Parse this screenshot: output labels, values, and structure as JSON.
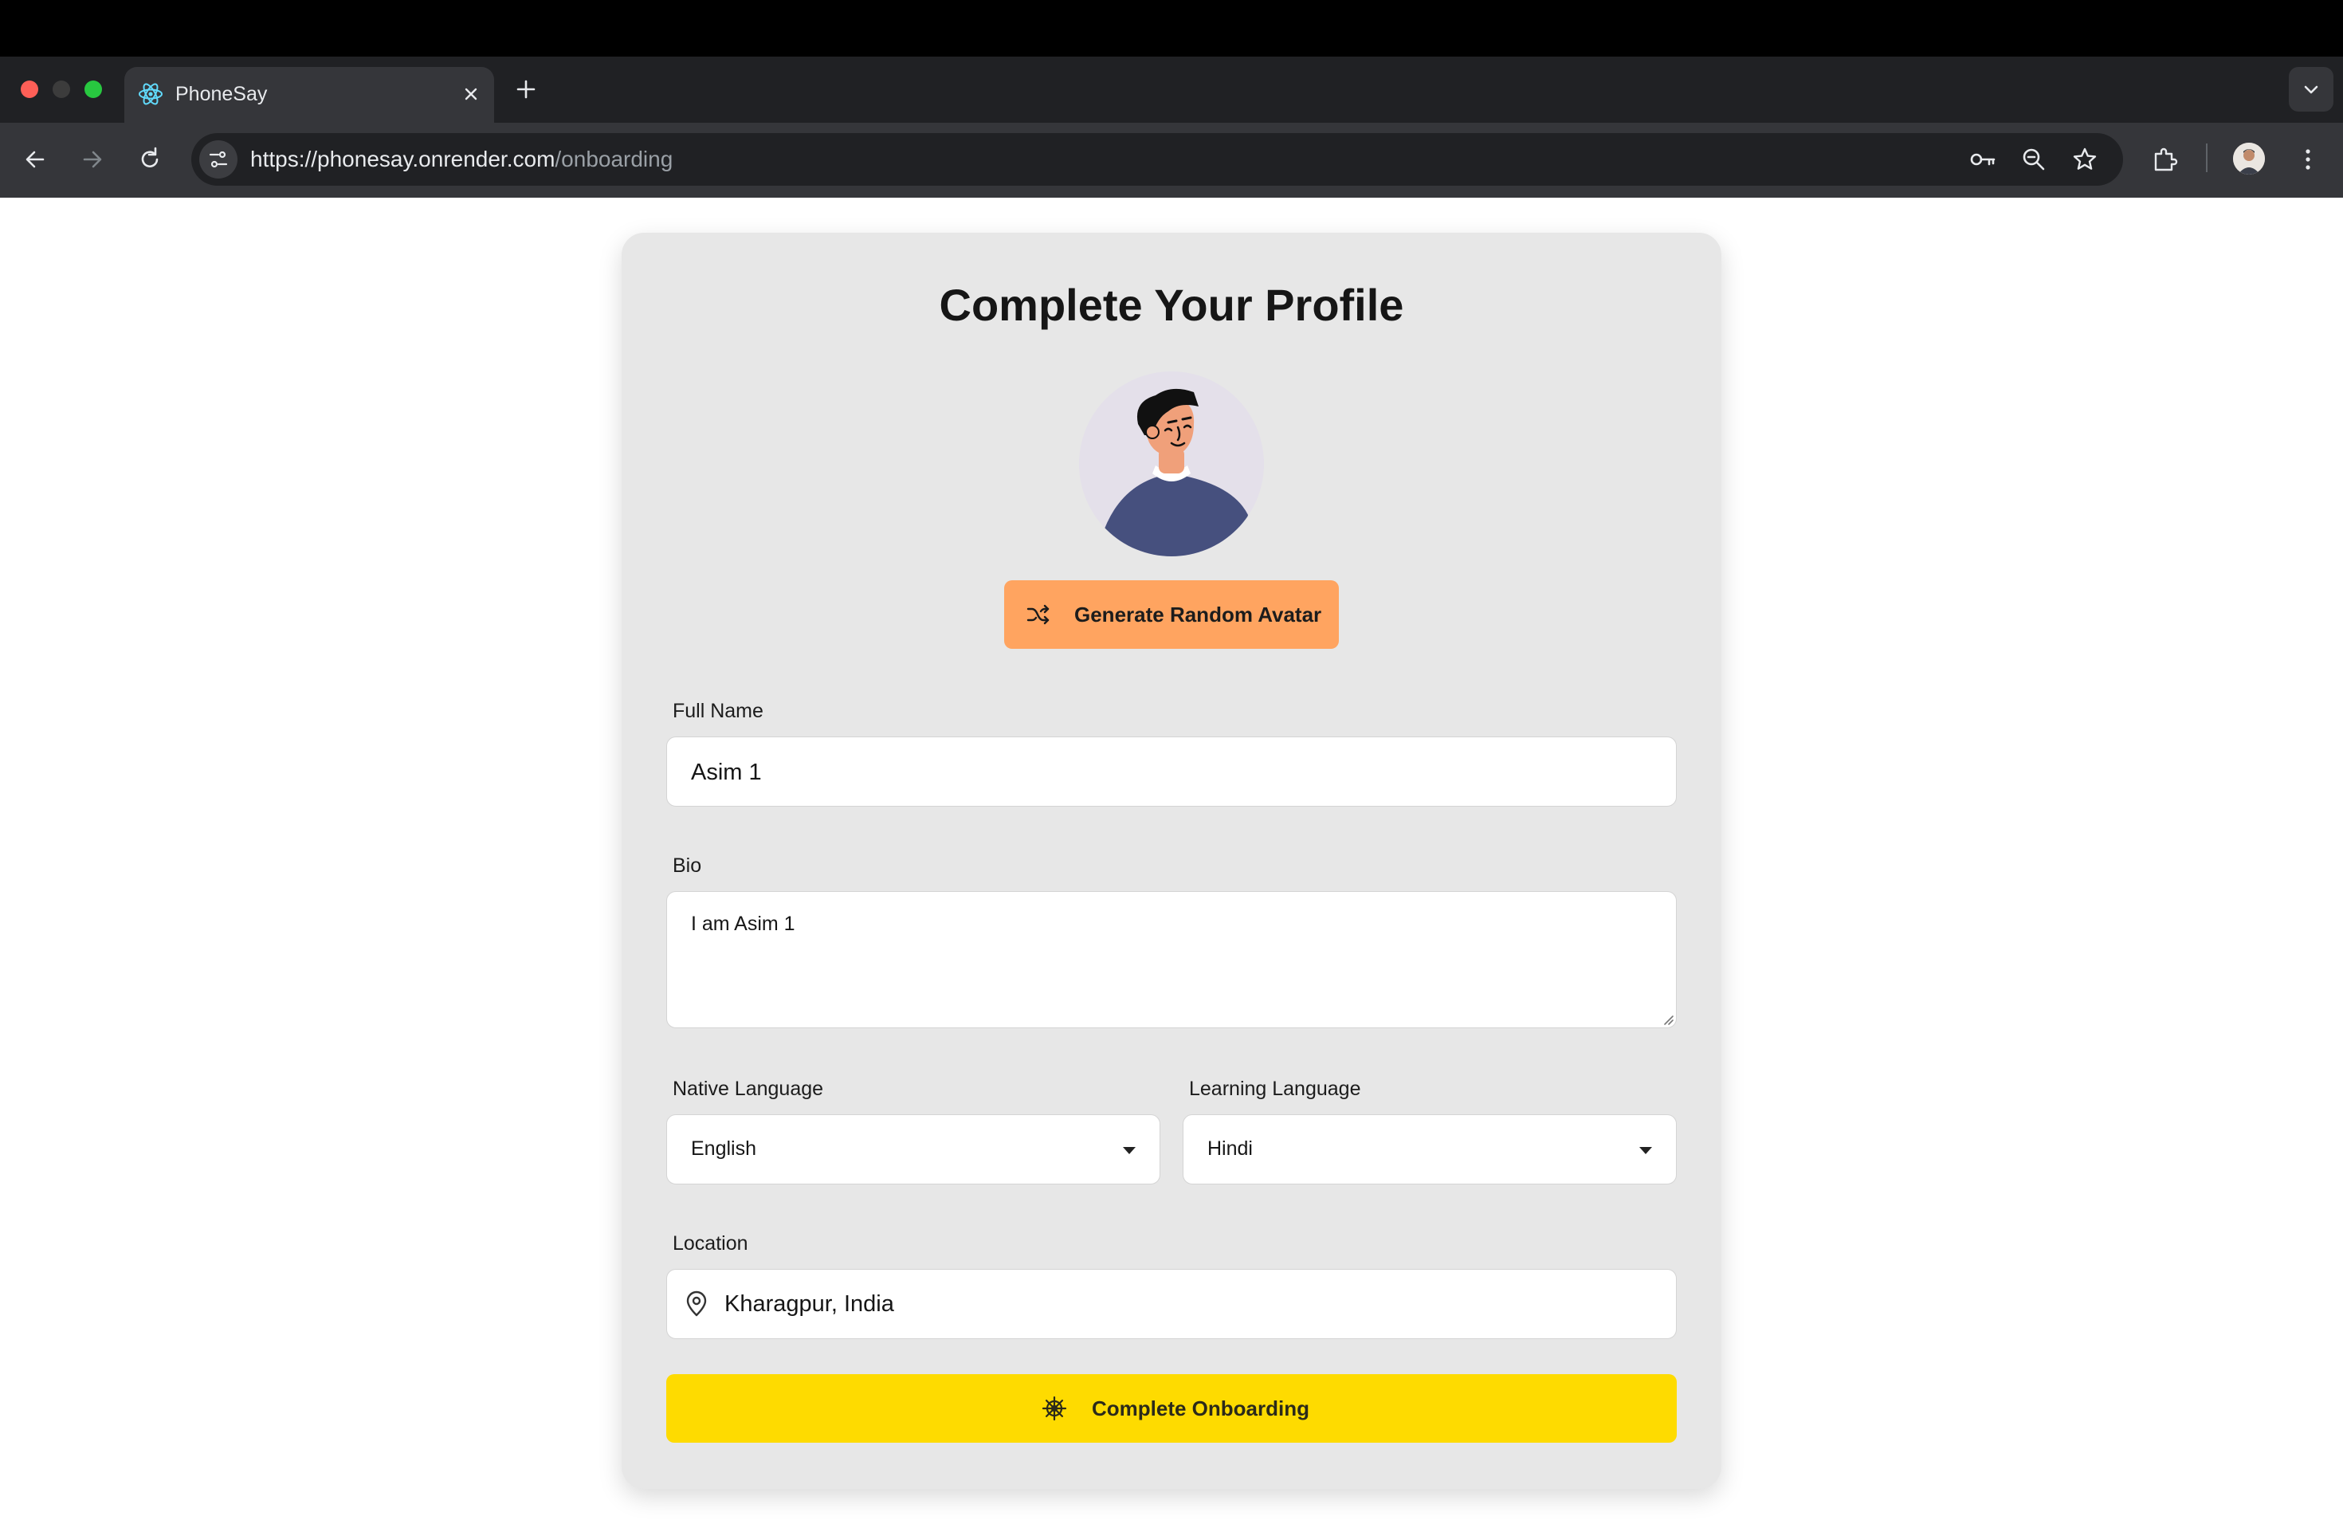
{
  "browser": {
    "tab_title": "PhoneSay",
    "url_host": "https://phonesay.onrender.com",
    "url_path": "/onboarding"
  },
  "form": {
    "title": "Complete Your Profile",
    "generate_avatar_label": "Generate Random Avatar",
    "full_name": {
      "label": "Full Name",
      "value": "Asim 1"
    },
    "bio": {
      "label": "Bio",
      "value": "I am Asim 1"
    },
    "native_language": {
      "label": "Native Language",
      "value": "English"
    },
    "learning_language": {
      "label": "Learning Language",
      "value": "Hindi"
    },
    "location": {
      "label": "Location",
      "value": "Kharagpur, India"
    },
    "submit_label": "Complete Onboarding"
  },
  "colors": {
    "accent_orange": "#ffa460",
    "accent_yellow": "#fedb00",
    "card_bg": "#e7e7e7"
  },
  "icons": [
    "react-favicon-icon",
    "close-icon",
    "plus-icon",
    "back-icon",
    "forward-icon",
    "reload-icon",
    "site-info-icon",
    "key-icon",
    "zoom-icon",
    "star-icon",
    "extensions-icon",
    "menu-icon",
    "shuffle-icon",
    "map-pin-icon",
    "ship-wheel-icon"
  ]
}
